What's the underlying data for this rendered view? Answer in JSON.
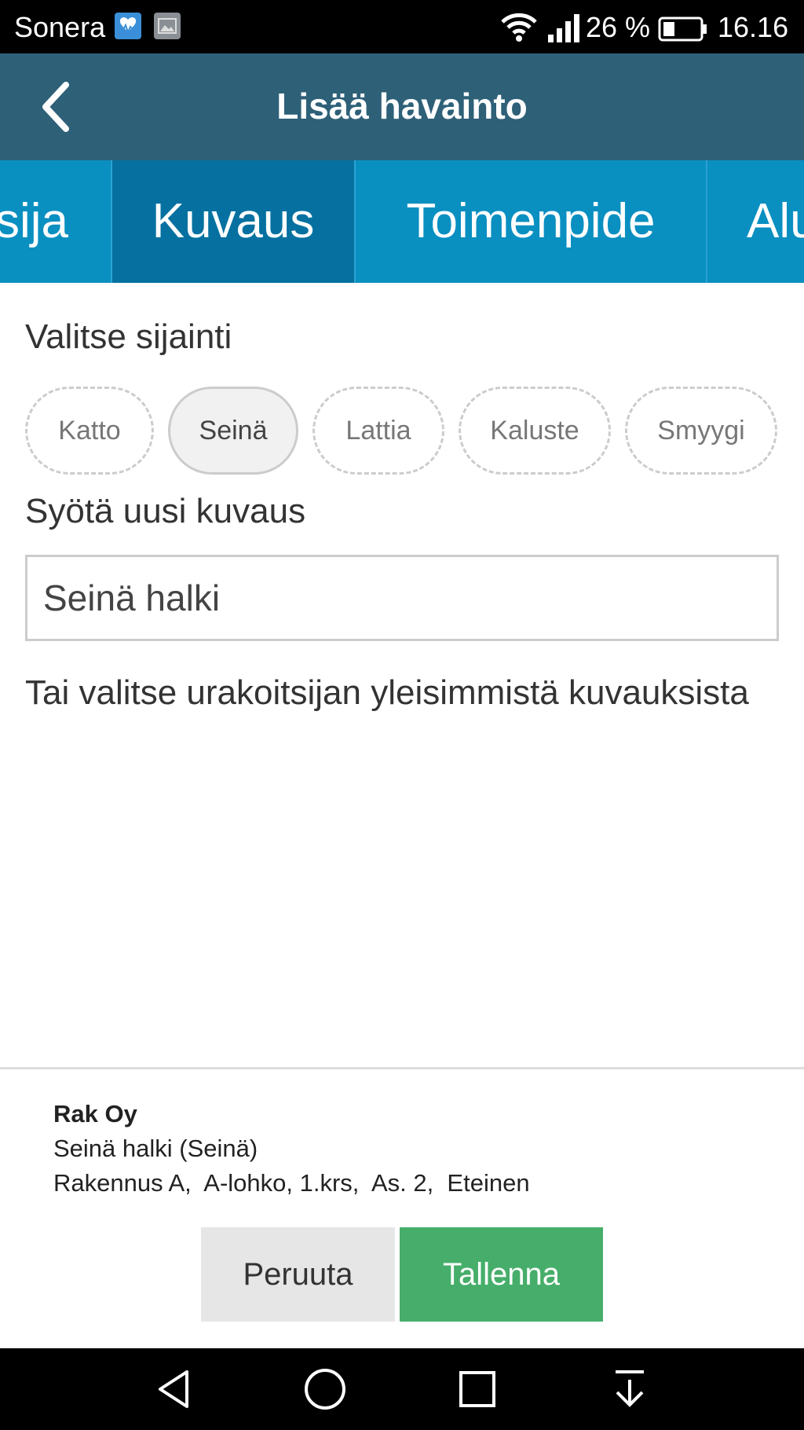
{
  "status_bar": {
    "carrier": "Sonera",
    "battery_percent": "26 %",
    "time": "16.16",
    "icons": [
      "health-icon",
      "gallery-icon",
      "wifi-icon",
      "signal-icon",
      "battery-icon"
    ]
  },
  "header": {
    "title": "Lisää havainto",
    "back_icon": "chevron-left-icon"
  },
  "tabs": [
    {
      "label": "sija",
      "active": false
    },
    {
      "label": "Kuvaus",
      "active": true
    },
    {
      "label": "Toimenpide",
      "active": false
    },
    {
      "label": "Alu",
      "active": false
    }
  ],
  "location": {
    "label": "Valitse sijainti",
    "options": [
      "Katto",
      "Seinä",
      "Lattia",
      "Kaluste",
      "Smyygi"
    ],
    "selected": "Seinä"
  },
  "description": {
    "label": "Syötä uusi kuvaus",
    "value": "Seinä halki",
    "hint": "Tai valitse urakoitsijan yleisimmistä kuvauksista"
  },
  "summary": {
    "company": "Rak Oy",
    "line1": "Seinä halki (Seinä)",
    "line2": "Rakennus A,  A-lohko, 1.krs,  As. 2,  Eteinen"
  },
  "actions": {
    "cancel_label": "Peruuta",
    "save_label": "Tallenna"
  },
  "colors": {
    "header": "#2e6078",
    "tabbar": "#0a8fc1",
    "tab_active": "#0671a0",
    "save_button": "#46ae6a"
  },
  "nav_bar": {
    "icons": [
      "back-triangle-icon",
      "home-circle-icon",
      "recents-square-icon",
      "notification-pull-icon"
    ]
  }
}
